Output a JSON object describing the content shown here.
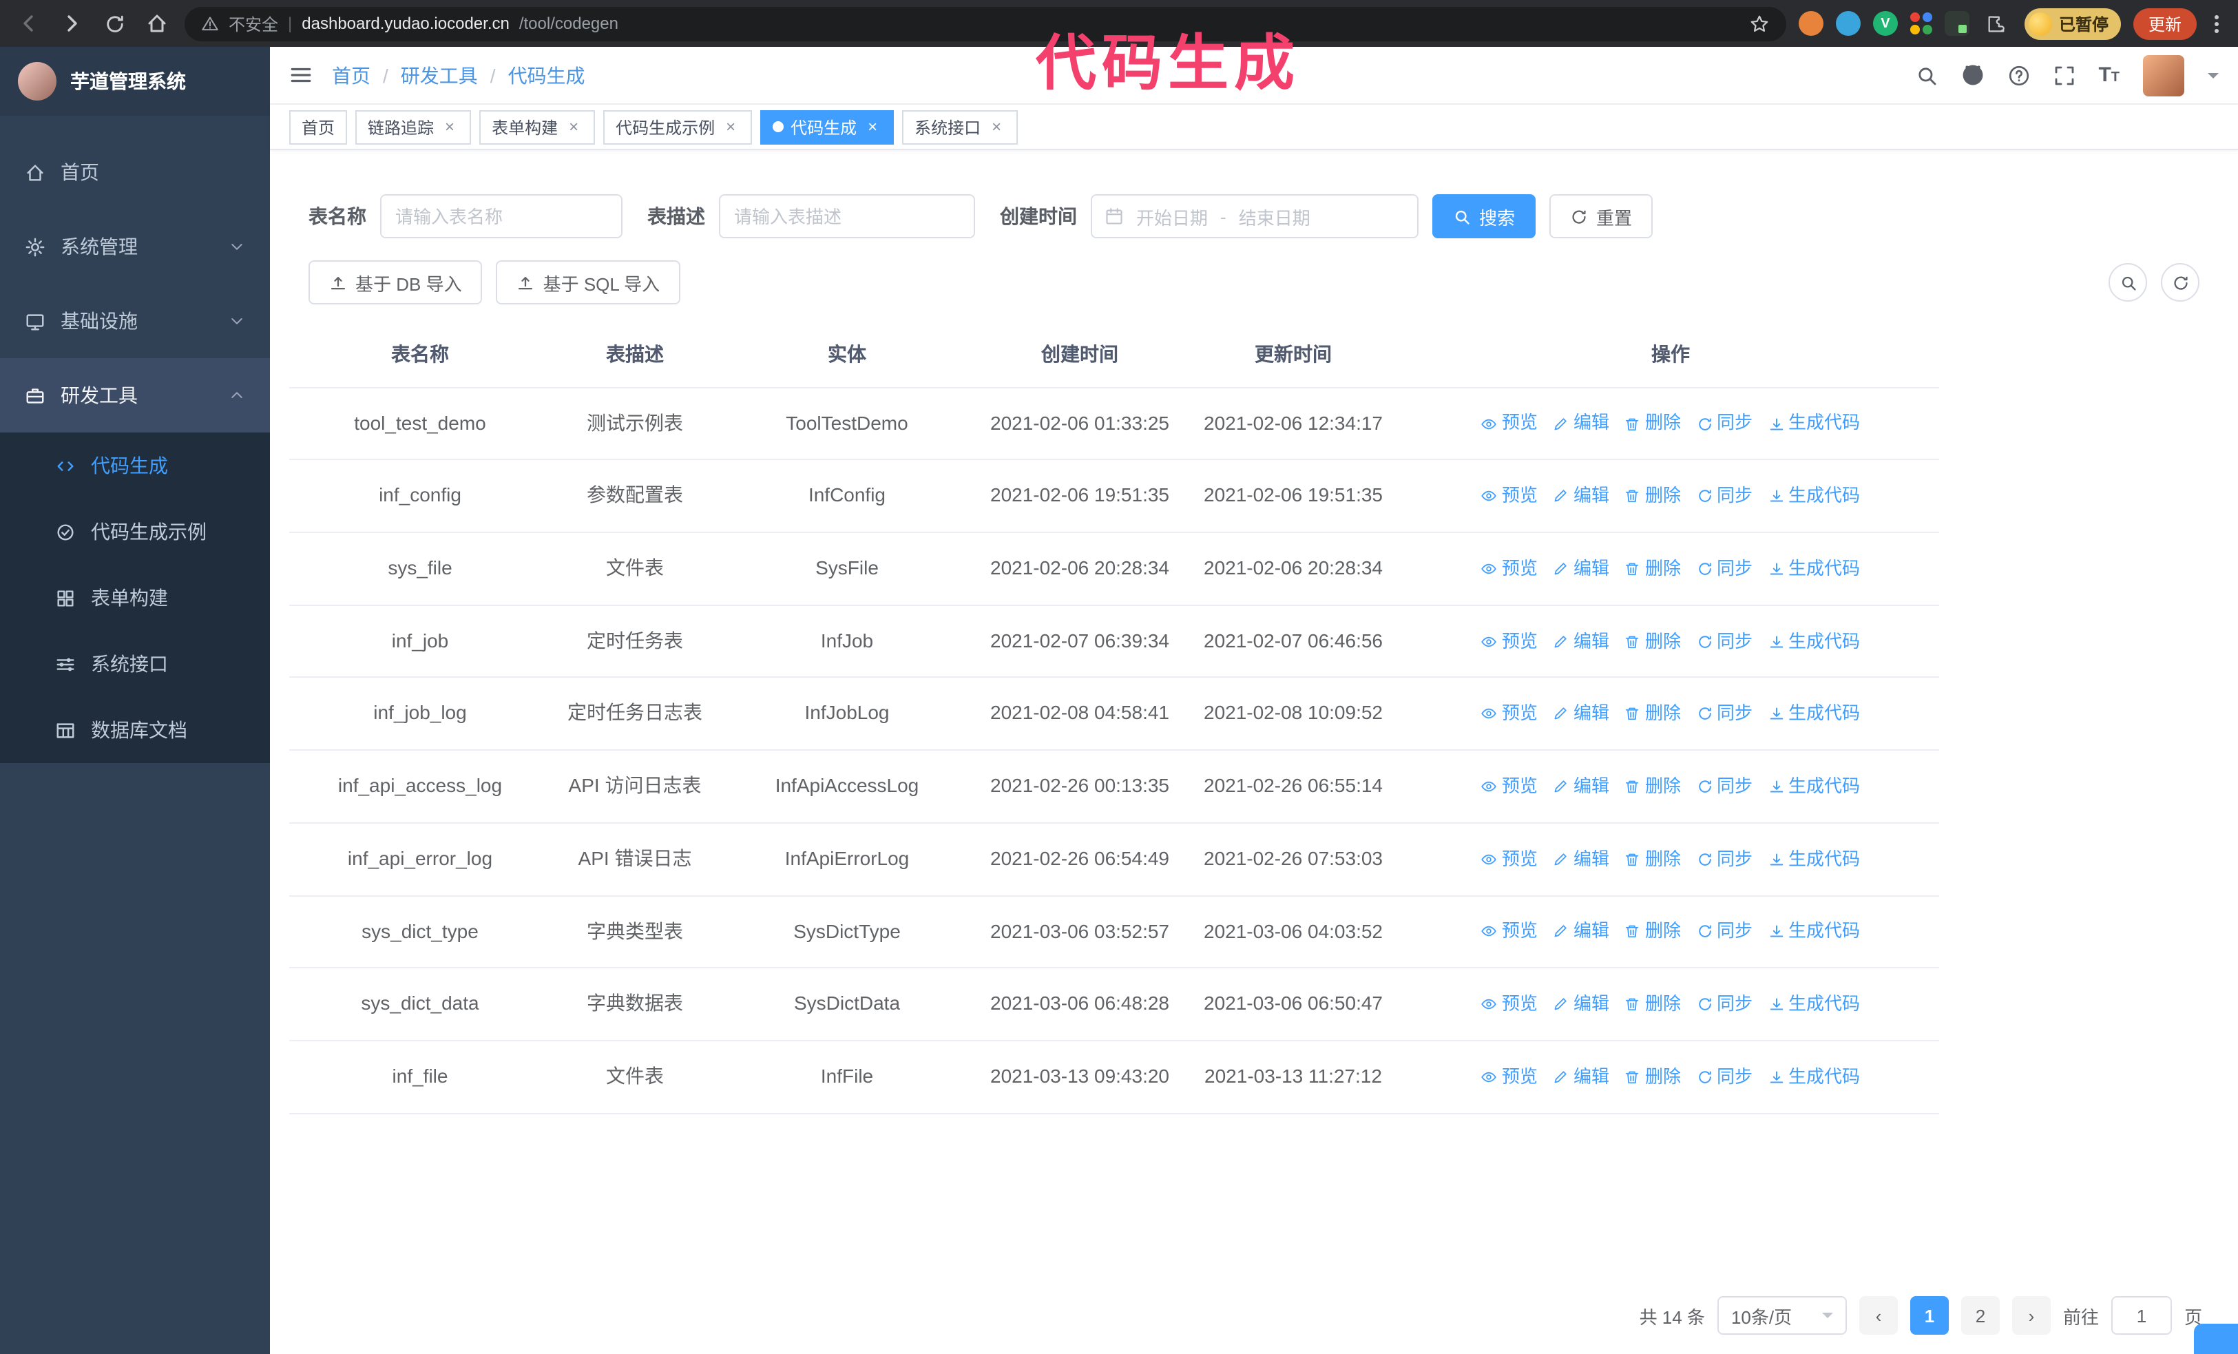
{
  "annotation": {
    "text": "代码生成"
  },
  "browser": {
    "security_label": "不安全",
    "url_host": "dashboard.yudao.iocoder.cn",
    "url_path": "/tool/codegen",
    "paused_badge": "已暂停",
    "update_button": "更新",
    "extension_v_label": "V"
  },
  "sidebar": {
    "logo_title": "芋道管理系统",
    "items": [
      {
        "label": "首页",
        "icon": "home",
        "expandable": false,
        "expanded": false
      },
      {
        "label": "系统管理",
        "icon": "gear",
        "expandable": true,
        "expanded": false
      },
      {
        "label": "基础设施",
        "icon": "monitor",
        "expandable": true,
        "expanded": false
      },
      {
        "label": "研发工具",
        "icon": "tools",
        "expandable": true,
        "expanded": true
      }
    ],
    "submenu": [
      {
        "label": "代码生成",
        "icon": "code",
        "active": true
      },
      {
        "label": "代码生成示例",
        "icon": "example",
        "active": false
      },
      {
        "label": "表单构建",
        "icon": "form",
        "active": false
      },
      {
        "label": "系统接口",
        "icon": "api",
        "active": false
      },
      {
        "label": "数据库文档",
        "icon": "docdb",
        "active": false
      }
    ]
  },
  "header": {
    "breadcrumb": [
      "首页",
      "研发工具",
      "代码生成"
    ]
  },
  "tabs": [
    {
      "label": "首页",
      "closable": false,
      "active": false
    },
    {
      "label": "链路追踪",
      "closable": true,
      "active": false
    },
    {
      "label": "表单构建",
      "closable": true,
      "active": false
    },
    {
      "label": "代码生成示例",
      "closable": true,
      "active": false
    },
    {
      "label": "代码生成",
      "closable": true,
      "active": true
    },
    {
      "label": "系统接口",
      "closable": true,
      "active": false
    }
  ],
  "filters": {
    "table_name_label": "表名称",
    "table_name_placeholder": "请输入表名称",
    "table_desc_label": "表描述",
    "table_desc_placeholder": "请输入表描述",
    "create_time_label": "创建时间",
    "date_start_placeholder": "开始日期",
    "date_separator": "-",
    "date_end_placeholder": "结束日期",
    "search_button": "搜索",
    "reset_button": "重置"
  },
  "toolbar": {
    "import_db": "基于 DB 导入",
    "import_sql": "基于 SQL 导入"
  },
  "table": {
    "columns": [
      "表名称",
      "表描述",
      "实体",
      "创建时间",
      "更新时间",
      "操作"
    ],
    "actions": [
      "预览",
      "编辑",
      "删除",
      "同步",
      "生成代码"
    ],
    "rows": [
      {
        "name": "tool_test_demo",
        "desc": "测试示例表",
        "entity": "ToolTestDemo",
        "created": "2021-02-06 01:33:25",
        "updated": "2021-02-06 12:34:17"
      },
      {
        "name": "inf_config",
        "desc": "参数配置表",
        "entity": "InfConfig",
        "created": "2021-02-06 19:51:35",
        "updated": "2021-02-06 19:51:35"
      },
      {
        "name": "sys_file",
        "desc": "文件表",
        "entity": "SysFile",
        "created": "2021-02-06 20:28:34",
        "updated": "2021-02-06 20:28:34"
      },
      {
        "name": "inf_job",
        "desc": "定时任务表",
        "entity": "InfJob",
        "created": "2021-02-07 06:39:34",
        "updated": "2021-02-07 06:46:56"
      },
      {
        "name": "inf_job_log",
        "desc": "定时任务日志表",
        "entity": "InfJobLog",
        "created": "2021-02-08 04:58:41",
        "updated": "2021-02-08 10:09:52"
      },
      {
        "name": "inf_api_access_log",
        "desc": "API 访问日志表",
        "entity": "InfApiAccessLog",
        "created": "2021-02-26 00:13:35",
        "updated": "2021-02-26 06:55:14"
      },
      {
        "name": "inf_api_error_log",
        "desc": "API 错误日志",
        "entity": "InfApiErrorLog",
        "created": "2021-02-26 06:54:49",
        "updated": "2021-02-26 07:53:03"
      },
      {
        "name": "sys_dict_type",
        "desc": "字典类型表",
        "entity": "SysDictType",
        "created": "2021-03-06 03:52:57",
        "updated": "2021-03-06 04:03:52"
      },
      {
        "name": "sys_dict_data",
        "desc": "字典数据表",
        "entity": "SysDictData",
        "created": "2021-03-06 06:48:28",
        "updated": "2021-03-06 06:50:47"
      },
      {
        "name": "inf_file",
        "desc": "文件表",
        "entity": "InfFile",
        "created": "2021-03-13 09:43:20",
        "updated": "2021-03-13 11:27:12"
      }
    ]
  },
  "pagination": {
    "total": "共 14 条",
    "page_size": "10条/页",
    "pages": [
      "1",
      "2"
    ],
    "active_page": "1",
    "goto_label": "前往",
    "goto_value": "1",
    "goto_suffix": "页"
  },
  "colors": {
    "accent_blue": "#409eff",
    "sidebar_bg": "#304156",
    "submenu_bg": "#1f2d3d",
    "annotation_pink": "#f4406d",
    "update_button_bg": "#cf4b2e"
  }
}
